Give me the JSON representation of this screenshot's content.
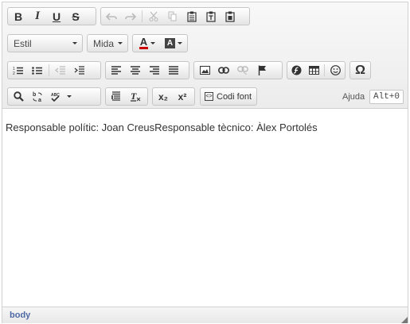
{
  "toolbar": {
    "row1": {
      "bold": "B",
      "italic": "I",
      "underline": "U",
      "strike": "S"
    },
    "row2": {
      "style_combo": "Estil",
      "size_combo": "Mida",
      "text_color": "A",
      "bg_color": "A"
    },
    "row4": {
      "source_label": "Codi font",
      "subscript": "x₂",
      "superscript": "x²"
    },
    "help_label": "Ajuda",
    "help_shortcut": "Alt+0",
    "icons": [
      "undo-icon",
      "redo-icon",
      "cut-icon",
      "copy-icon",
      "paste-icon",
      "paste-text-icon",
      "paste-word-icon",
      "numbered-list-icon",
      "bulleted-list-icon",
      "outdent-icon",
      "indent-icon",
      "align-left-icon",
      "align-center-icon",
      "align-right-icon",
      "justify-icon",
      "image-icon",
      "link-icon",
      "unlink-icon",
      "anchor-icon",
      "flash-icon",
      "table-icon",
      "smiley-icon",
      "omega-icon",
      "find-icon",
      "replace-icon",
      "spellcheck-icon",
      "blockquote-icon",
      "remove-format-icon",
      "source-icon",
      "resize-handle-icon"
    ]
  },
  "content": {
    "text": "Responsable polític: Joan CreusResponsable tècnico: Àlex Portolés"
  },
  "statusbar": {
    "path": "body"
  },
  "colors": {
    "toolbar_bg": "#ececec",
    "border": "#d1d1d1",
    "path_link": "#4d68a3",
    "text_color_bar": "#cc0000"
  }
}
